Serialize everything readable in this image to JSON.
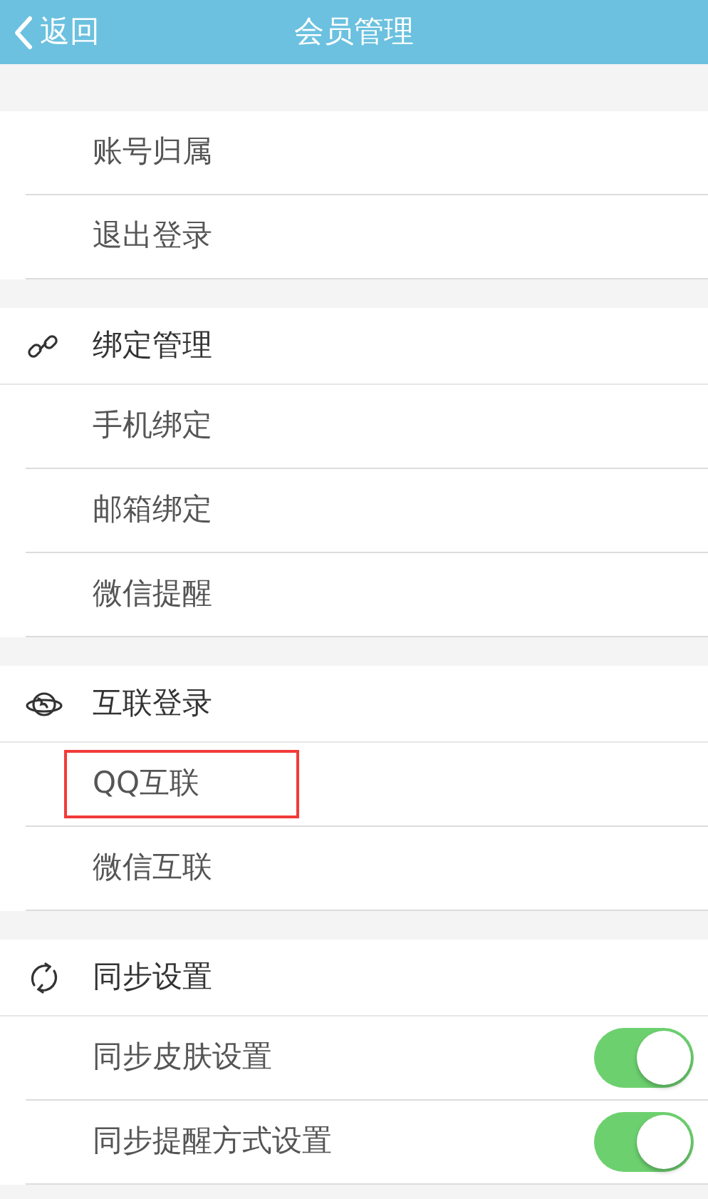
{
  "nav_bar": {
    "back": "返回",
    "title": "会员管理"
  },
  "sections": [
    {
      "items": [
        {
          "label": "账号归属",
          "kind": "link",
          "highlighted": false
        },
        {
          "label": "退出登录",
          "kind": "link",
          "highlighted": false
        }
      ]
    },
    {
      "title": "绑定管理",
      "kind": "link",
      "items": [
        {
          "label": "手机绑定",
          "kind": "link",
          "highlighted": false
        },
        {
          "label": "邮箱绑定",
          "kind": "link",
          "highlighted": false
        },
        {
          "label": "微信提醒",
          "kind": "link",
          "highlighted": false
        }
      ]
    },
    {
      "title": "互联登录",
      "kind": "globe",
      "items": [
        {
          "label": "QQ互联",
          "kind": "link",
          "highlighted": true
        },
        {
          "label": "微信互联",
          "kind": "link",
          "highlighted": false
        }
      ]
    },
    {
      "title": "同步设置",
      "kind": "sync",
      "items": [
        {
          "label": "同步皮肤设置",
          "kind": "toggle",
          "on": true,
          "highlighted": false
        },
        {
          "label": "同步提醒方式设置",
          "kind": "toggle",
          "on": true,
          "highlighted": false
        }
      ]
    }
  ]
}
